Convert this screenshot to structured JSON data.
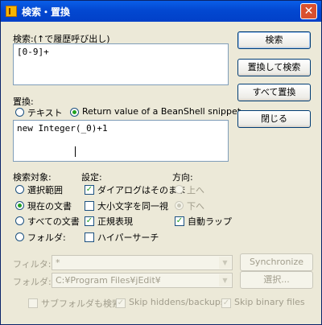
{
  "window": {
    "title": "検索・置換",
    "close_glyph": "✕"
  },
  "search": {
    "label": "検索:(↑で履歴呼び出し)",
    "value": "[0-9]+"
  },
  "replace": {
    "label": "置換:",
    "mode_text": "テキスト",
    "mode_beanshell": "Return value of a BeanShell snippet",
    "value": "new Integer(_0)+1"
  },
  "buttons": {
    "find": "検索",
    "replace_and_find": "置換して検索",
    "replace_all": "すべて置換",
    "close": "閉じる",
    "synchronize": "Synchronize",
    "choose": "選択..."
  },
  "scope": {
    "label": "検索対象:",
    "selection": "選択範囲",
    "current_buffer": "現在の文書",
    "all_buffers": "すべての文書",
    "directory": "フォルダ:"
  },
  "settings": {
    "label": "設定:",
    "keep_dialog": "ダイアログはそのまま",
    "ignore_case": "大小文字を同一視",
    "regexp": "正規表現",
    "hypersearch": "ハイパーサーチ"
  },
  "direction": {
    "label": "方向:",
    "up": "上へ",
    "down": "下へ",
    "wrap": "自動ラップ"
  },
  "filter": {
    "label": "フィルタ:",
    "value": "*"
  },
  "folder": {
    "label": "フォルダ:",
    "value": "C:¥Program Files¥jEdit¥"
  },
  "options": {
    "subfolders": "サブフォルダも検索",
    "skip_hidden": "Skip hiddens/backups",
    "skip_binary": "Skip binary files"
  },
  "colors": {
    "titlebar": "#0348d1",
    "dialog_bg": "#ece9d8",
    "checked_mark": "#21a121"
  }
}
